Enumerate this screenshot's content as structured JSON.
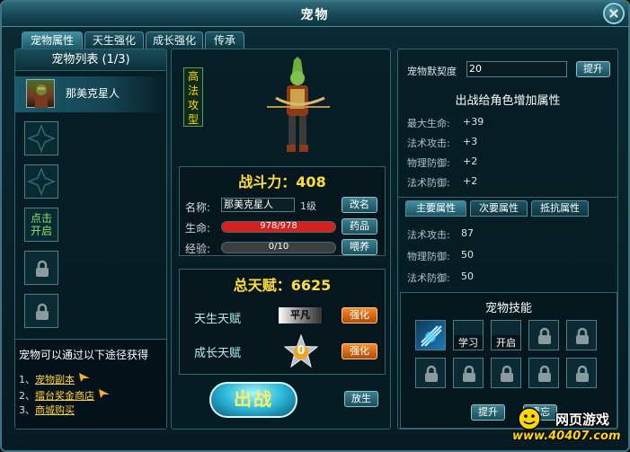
{
  "window": {
    "title": "宠物",
    "close_label": "×"
  },
  "tabs": [
    {
      "label": "宠物属性",
      "active": true
    },
    {
      "label": "天生强化",
      "active": false
    },
    {
      "label": "成长强化",
      "active": false
    },
    {
      "label": "传承",
      "active": false
    }
  ],
  "pet_list": {
    "header": "宠物列表 (1/3)",
    "selected_pet_name": "那美克星人",
    "open_slot_label_1": "点击",
    "open_slot_label_2": "开启"
  },
  "obtain": {
    "title": "宠物可以通过以下途径获得",
    "items": [
      {
        "num": "1、",
        "text": "宠物副本"
      },
      {
        "num": "2、",
        "text": "擂台奖金商店"
      },
      {
        "num": "3、",
        "text": "商城购买"
      }
    ]
  },
  "pet_detail": {
    "type_label": "高法攻型",
    "combat_power_label": "战斗力：408",
    "name_label": "名称:",
    "name_value": "那美克星人",
    "level": "1级",
    "rename_button": "改名",
    "hp_label": "生命:",
    "hp_text": "978/978",
    "hp_fraction": 1.0,
    "medicine_button": "药品",
    "exp_label": "经验:",
    "exp_text": "0/10",
    "exp_fraction": 0.0,
    "feed_button": "喂养",
    "colors": {
      "hp": "#d62020",
      "exp": "#5a5a5a"
    }
  },
  "talent": {
    "total_label": "总天赋：6625",
    "innate_label": "天生天赋",
    "innate_grade": "平凡",
    "innate_button": "强化",
    "growth_label": "成长天赋",
    "growth_value": "0",
    "growth_button": "强化"
  },
  "actions": {
    "fight_button": "出战",
    "release_button": "放生"
  },
  "right_panel": {
    "bond_label": "宠物默契度",
    "bond_value": "20",
    "upgrade_button": "提升",
    "bonus_header": "出战给角色增加属性",
    "bonus_stats": [
      {
        "label": "最大生命:",
        "value": "+39"
      },
      {
        "label": "法术攻击:",
        "value": "+3"
      },
      {
        "label": "物理防御:",
        "value": "+2"
      },
      {
        "label": "法术防御:",
        "value": "+2"
      }
    ],
    "attr_tabs": [
      {
        "label": "主要属性",
        "active": true
      },
      {
        "label": "次要属性",
        "active": false
      },
      {
        "label": "抵抗属性",
        "active": false
      }
    ],
    "main_stats": [
      {
        "label": "法术攻击:",
        "value": "87"
      },
      {
        "label": "物理防御:",
        "value": "50"
      },
      {
        "label": "法术防御:",
        "value": "50"
      }
    ]
  },
  "skills": {
    "header": "宠物技能",
    "learn_label": "学习",
    "open_label": "开启",
    "upgrade_button": "提升",
    "forget_button": "遗忘"
  },
  "watermark": {
    "line1": "网页游戏",
    "line2": "www.40407.com"
  }
}
